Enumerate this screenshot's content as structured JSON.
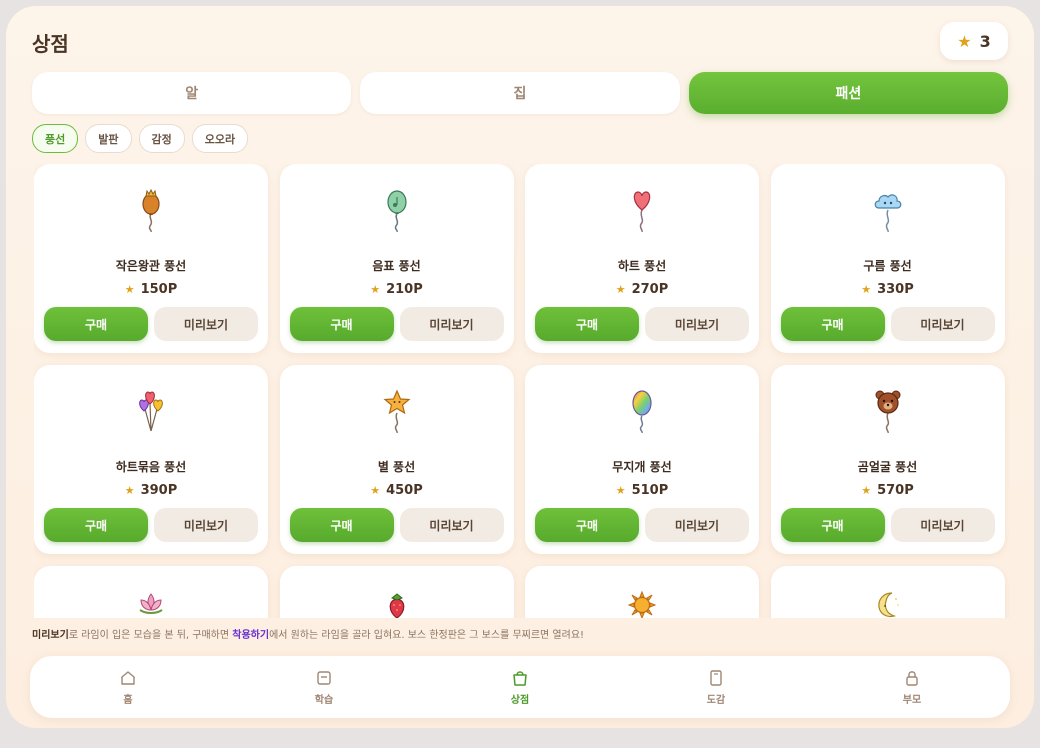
{
  "header": {
    "title": "상점",
    "star_count": "3"
  },
  "tabs": [
    {
      "label": "알",
      "active": false
    },
    {
      "label": "집",
      "active": false
    },
    {
      "label": "패션",
      "active": true
    }
  ],
  "chips": [
    {
      "label": "풍선",
      "active": true
    },
    {
      "label": "발판",
      "active": false
    },
    {
      "label": "감정",
      "active": false
    },
    {
      "label": "오오라",
      "active": false
    }
  ],
  "buttons": {
    "buy": "구매",
    "preview": "미리보기"
  },
  "items": [
    {
      "name": "작은왕관 풍선",
      "price": "150P",
      "icon": "crown-balloon-icon"
    },
    {
      "name": "음표 풍선",
      "price": "210P",
      "icon": "note-balloon-icon"
    },
    {
      "name": "하트 풍선",
      "price": "270P",
      "icon": "heart-balloon-icon"
    },
    {
      "name": "구름 풍선",
      "price": "330P",
      "icon": "cloud-balloon-icon"
    },
    {
      "name": "하트묶음 풍선",
      "price": "390P",
      "icon": "heart-bunch-balloon-icon"
    },
    {
      "name": "별 풍선",
      "price": "450P",
      "icon": "star-balloon-icon"
    },
    {
      "name": "무지개 풍선",
      "price": "510P",
      "icon": "rainbow-balloon-icon"
    },
    {
      "name": "곰얼굴 풍선",
      "price": "570P",
      "icon": "bear-balloon-icon"
    },
    {
      "name": "",
      "price": "",
      "icon": "lotus-icon"
    },
    {
      "name": "",
      "price": "",
      "icon": "strawberry-icon"
    },
    {
      "name": "",
      "price": "",
      "icon": "sun-icon"
    },
    {
      "name": "",
      "price": "",
      "icon": "moon-icon"
    }
  ],
  "notice": {
    "part1": "미리보기",
    "part2": "로 라임이 입은 모습을 본 뒤, 구매하면 ",
    "part3": "착용하기",
    "part4": "에서 원하는 라임을 골라 입혀요. 보스 한정판은 그 보스를 무찌르면 열려요!"
  },
  "nav": [
    {
      "label": "홈",
      "icon": "home-icon",
      "active": false
    },
    {
      "label": "학습",
      "icon": "study-icon",
      "active": false
    },
    {
      "label": "상점",
      "icon": "shop-bag-icon",
      "active": true
    },
    {
      "label": "도감",
      "icon": "book-icon",
      "active": false
    },
    {
      "label": "부모",
      "icon": "lock-icon",
      "active": false
    }
  ],
  "colors": {
    "accent": "#5aae2e",
    "star": "#e0a21a",
    "background": "#fdf4ea",
    "link": "#6a30d0"
  }
}
